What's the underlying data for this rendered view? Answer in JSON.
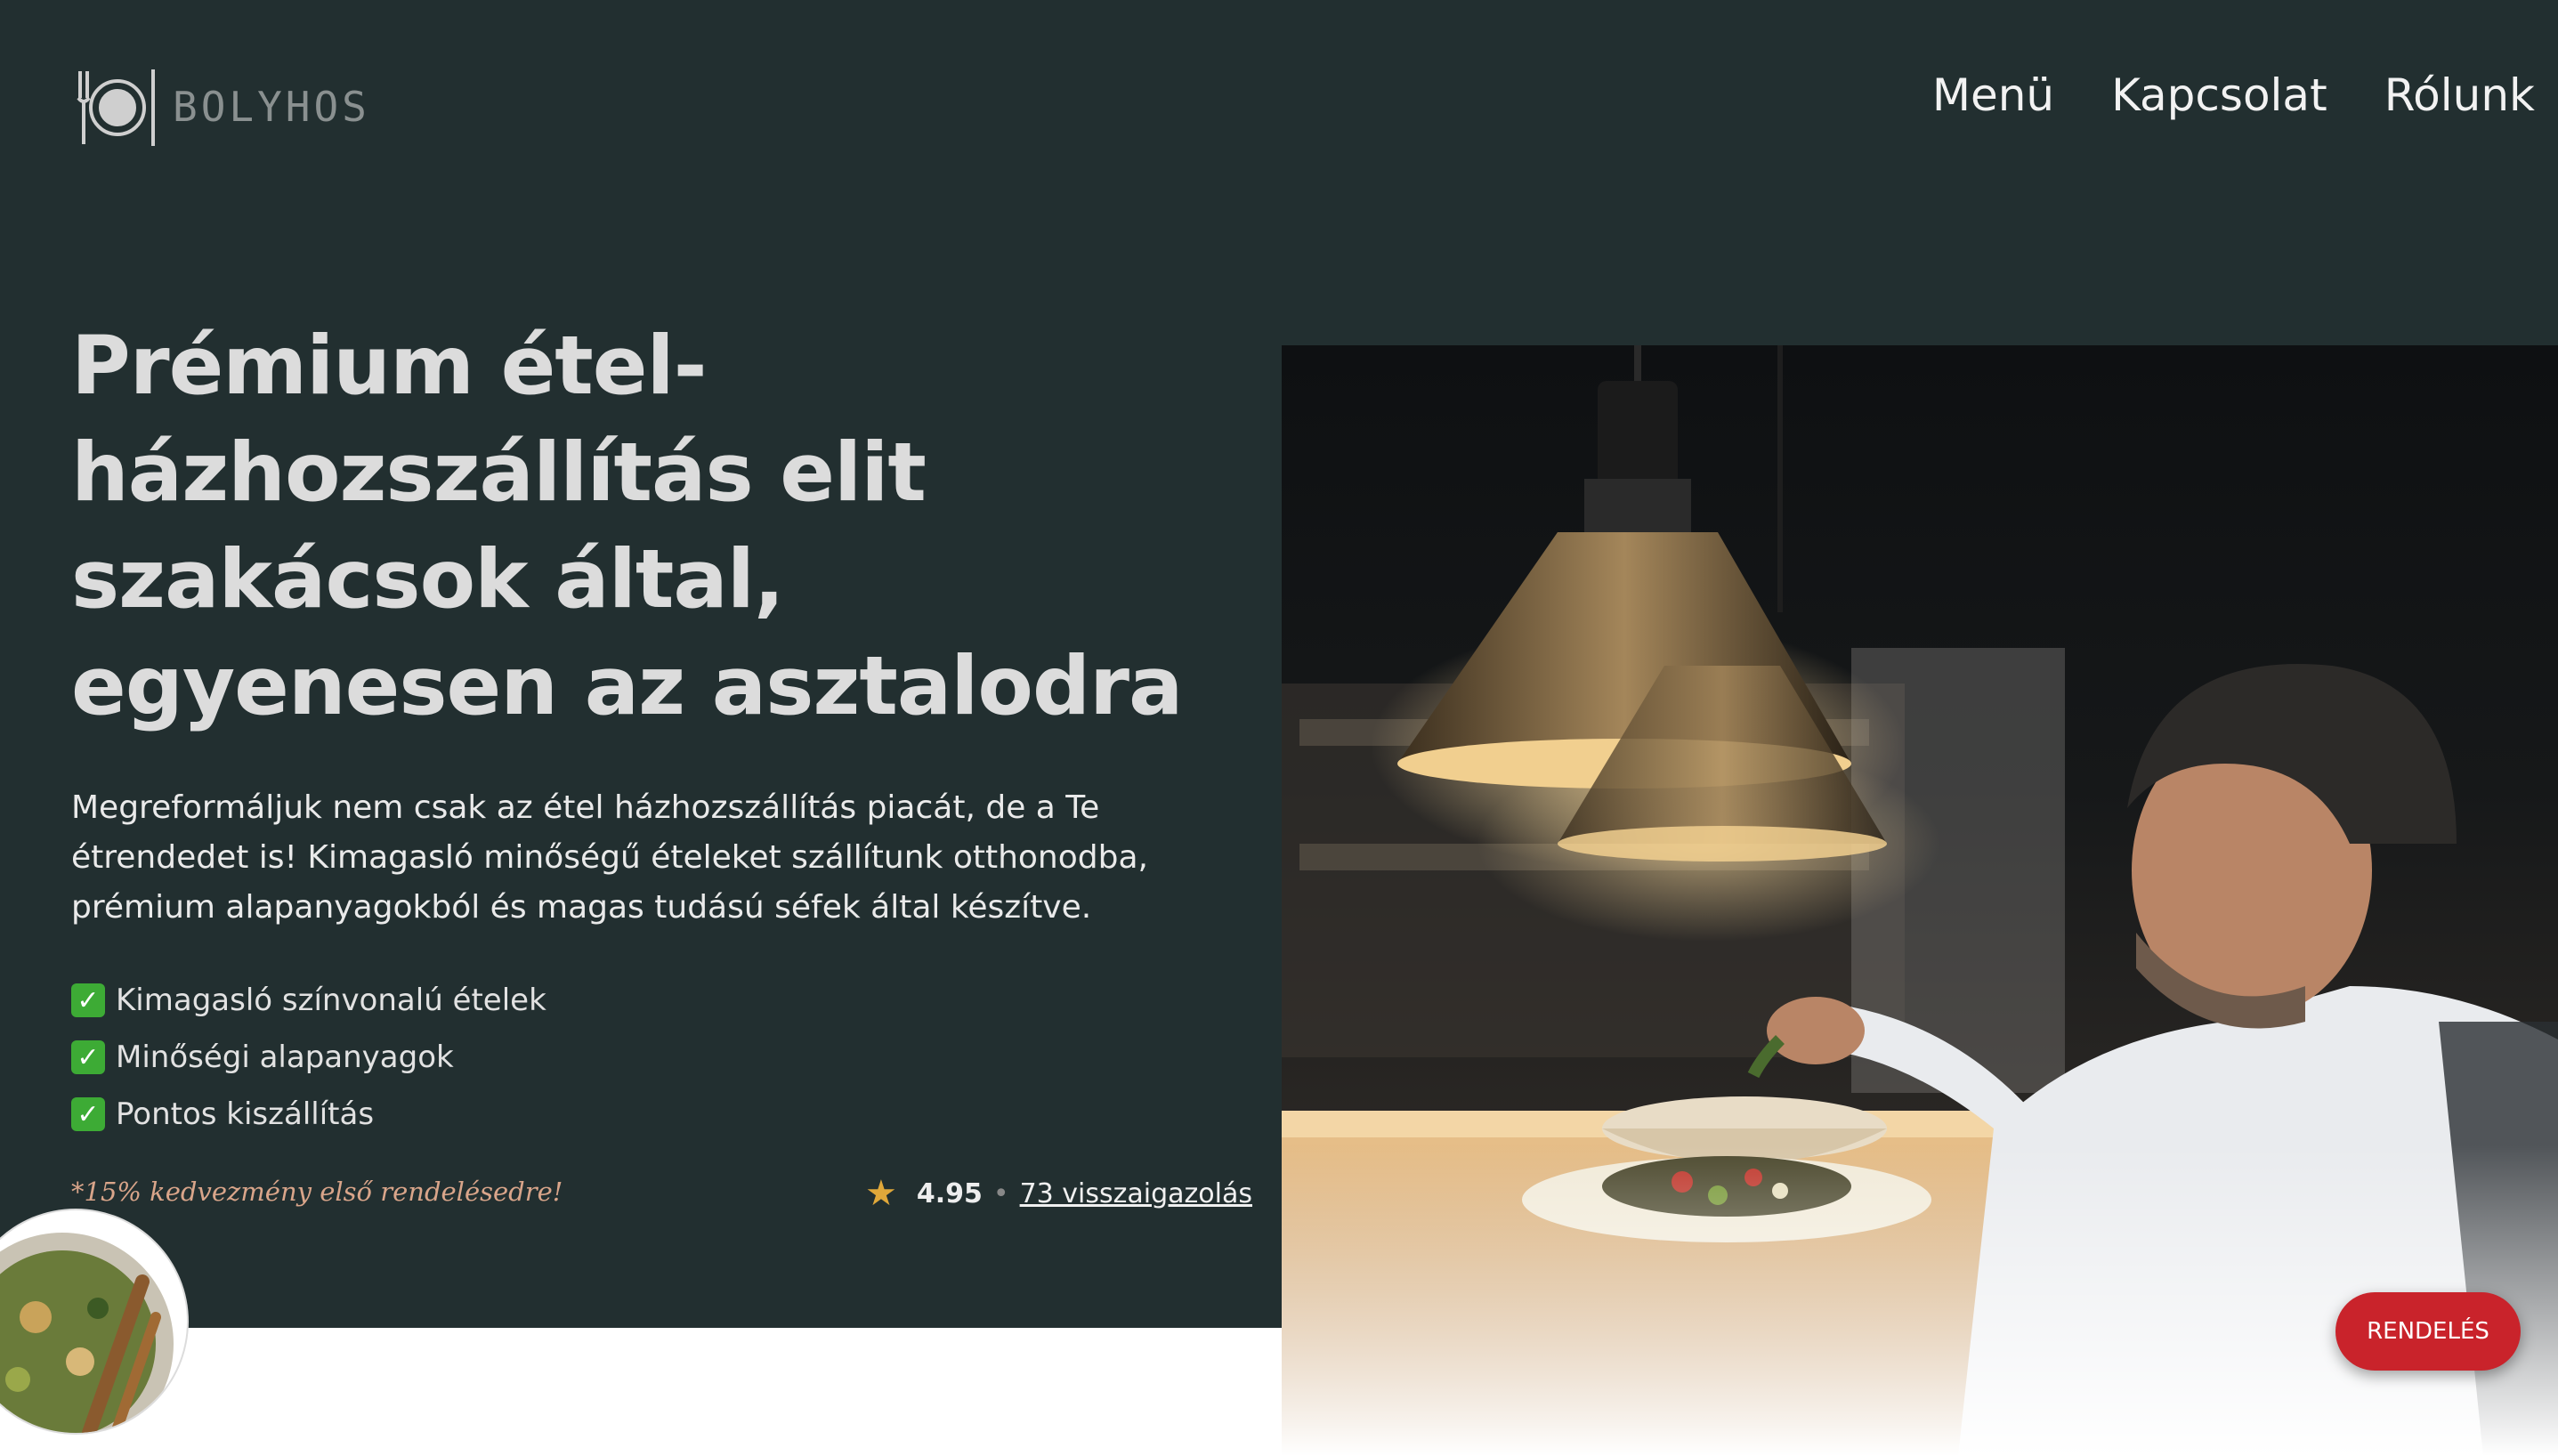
{
  "header": {
    "logo_text": "BOLYHOS",
    "nav": [
      {
        "label": "Menü"
      },
      {
        "label": "Kapcsolat"
      },
      {
        "label": "Rólunk"
      }
    ]
  },
  "hero": {
    "title": "Prémium étel-házhozszállítás elit szakácsok által, egyenesen az asztalodra",
    "description": "Megreformáljuk nem csak az étel házhozszállítás piacát, de a Te étrendedet is! Kimagasló minőségű ételeket szállítunk otthonodba, prémium alapanyagokból és magas tudású séfek által készítve.",
    "features": [
      {
        "text": "Kimagasló színvonalú ételek",
        "icon": "check-mark-icon"
      },
      {
        "text": "Minőségi alapanyagok",
        "icon": "check-mark-icon"
      },
      {
        "text": "Pontos kiszállítás",
        "icon": "check-mark-icon"
      }
    ],
    "promo": "*15% kedvezmény első rendelésedre!",
    "rating": {
      "value": "4.95",
      "separator": "•",
      "reviews_link": "73 visszaigazolás"
    }
  },
  "cta": {
    "order_label": "RENDELÉS"
  },
  "colors": {
    "background": "#222f30",
    "accent_red": "#c9232b",
    "star": "#e0a83a",
    "check": "#3dab35",
    "promo": "#d9a58a"
  }
}
